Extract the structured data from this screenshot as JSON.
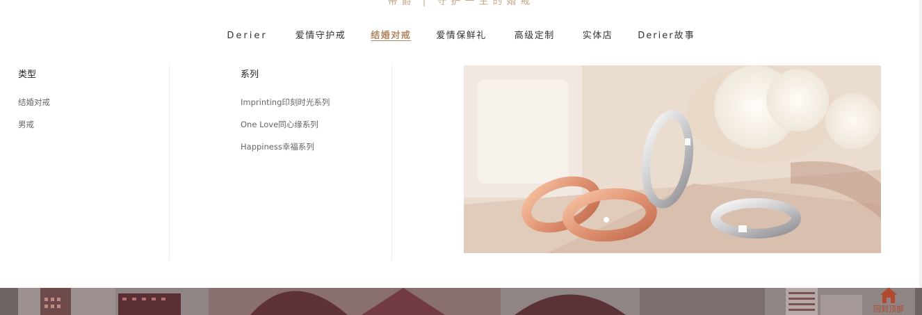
{
  "header": {
    "brand": "蒂爵",
    "separator": "|",
    "slogan": "守护一生的婚戒"
  },
  "nav": {
    "items": [
      {
        "label": "Derier"
      },
      {
        "label": "爱情守护戒"
      },
      {
        "label": "结婚对戒"
      },
      {
        "label": "爱情保鲜礼"
      },
      {
        "label": "高级定制"
      },
      {
        "label": "实体店"
      },
      {
        "label": "Derier故事"
      }
    ],
    "active_index": 2
  },
  "dropdown": {
    "type_heading": "类型",
    "type_items": [
      {
        "label": "结婚对戒"
      },
      {
        "label": "男戒"
      }
    ],
    "series_heading": "系列",
    "series_items": [
      {
        "label": "Imprinting印刻时光系列"
      },
      {
        "label": "One Love同心缘系列"
      },
      {
        "label": "Happiness幸福系列"
      }
    ]
  },
  "back_to_top": {
    "label": "回到顶部",
    "icon": "home-icon"
  },
  "colors": {
    "accent": "#b08763",
    "tagline": "#c9a98a",
    "back_to_top": "#b34a2f"
  }
}
